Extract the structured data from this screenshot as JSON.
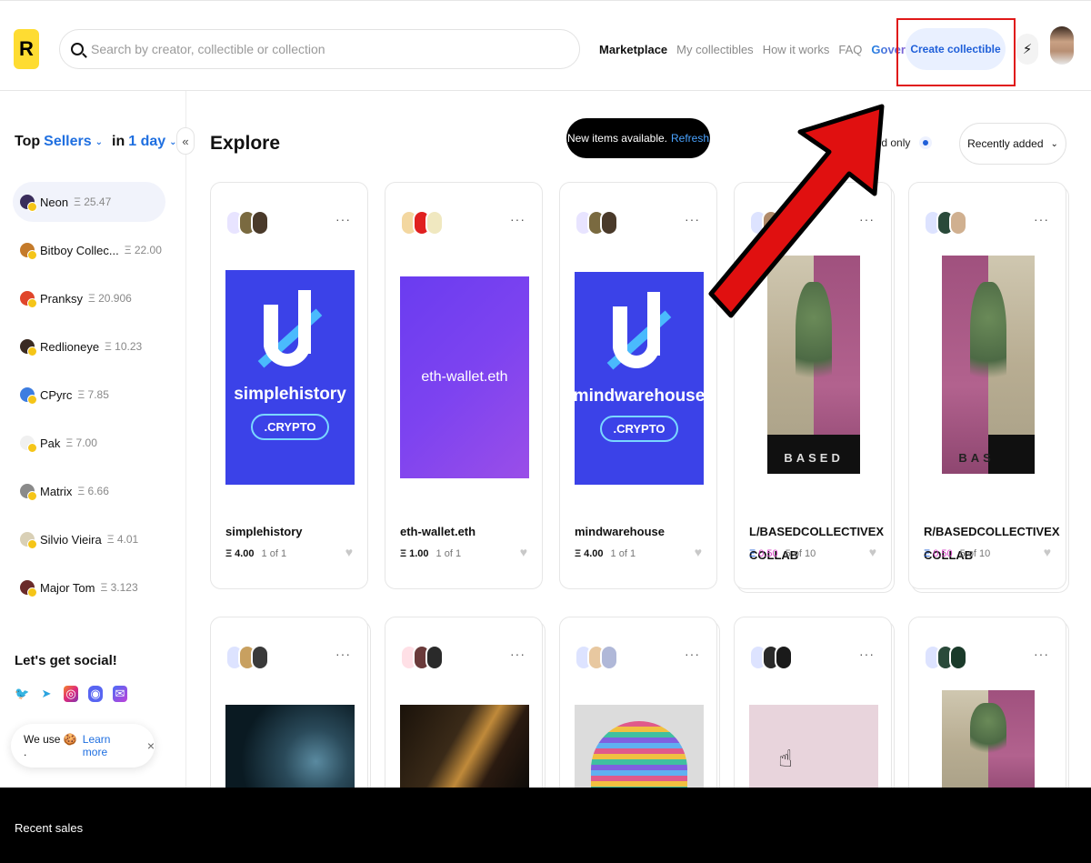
{
  "header": {
    "logo_letter": "R",
    "search_placeholder": "Search by creator, collectible or collection",
    "nav": [
      "Marketplace",
      "My collectibles",
      "How it works",
      "FAQ",
      "Governance"
    ],
    "create_label": "Create collectible",
    "bolt_icon": "bolt-icon"
  },
  "sidebar": {
    "title_top": "Top",
    "title_sellers": "Sellers",
    "title_in": "in",
    "title_period": "1 day",
    "collapse_label": "«",
    "sellers": [
      {
        "name": "Neon",
        "amount": "Ξ 25.47",
        "color": "#3a2d5c"
      },
      {
        "name": "Bitboy Collec...",
        "amount": "Ξ 22.00",
        "color": "#c47a2a"
      },
      {
        "name": "Pranksy",
        "amount": "Ξ 20.906",
        "color": "#e0452b"
      },
      {
        "name": "Redlioneye",
        "amount": "Ξ 10.23",
        "color": "#3a2a22"
      },
      {
        "name": "CPyrc",
        "amount": "Ξ 7.85",
        "color": "#3d7de0"
      },
      {
        "name": "Pak",
        "amount": "Ξ 7.00",
        "color": "#f0f0f0"
      },
      {
        "name": "Matrix",
        "amount": "Ξ 6.66",
        "color": "#8a8a8a"
      },
      {
        "name": "Silvio Vieira",
        "amount": "Ξ 4.01",
        "color": "#d9d0b6"
      },
      {
        "name": "Major Tom",
        "amount": "Ξ 3.123",
        "color": "#6a2a2a"
      }
    ],
    "social_title": "Let's get social!",
    "cookie_text": "We use 🍪 .",
    "cookie_link": "Learn more",
    "cookie_close": "×"
  },
  "main": {
    "title": "Explore",
    "toast_text": "New items available.",
    "toast_link": "Refresh",
    "verified_label": "ied only",
    "sort_label": "Recently added",
    "cards": [
      {
        "title": "simplehistory",
        "art_text": "simplehistory",
        "pill": ".CRYPTO",
        "eth": "Ξ 4.00",
        "edition": "1 of 1"
      },
      {
        "title": "eth-wallet.eth",
        "art_text": "eth-wallet.eth",
        "eth": "Ξ 1.00",
        "edition": "1 of 1"
      },
      {
        "title": "mindwarehouse",
        "art_text": "mindwarehouse",
        "pill": ".CRYPTO",
        "eth": "Ξ 4.00",
        "edition": "1 of 1"
      },
      {
        "title": "L/BASEDCOLLECTIVEXCOLLAB",
        "art_text": "BASED",
        "eth_prefix": "Ξ",
        "eth_value": "0.50",
        "edition": "5 of 10"
      },
      {
        "title": "R/BASEDCOLLECTIVEXCOLLAB",
        "art_text": "BAS",
        "eth_prefix": "Ξ",
        "eth_value": "0.50",
        "edition": "5 of 10"
      }
    ]
  },
  "footer": {
    "label": "Recent sales"
  }
}
